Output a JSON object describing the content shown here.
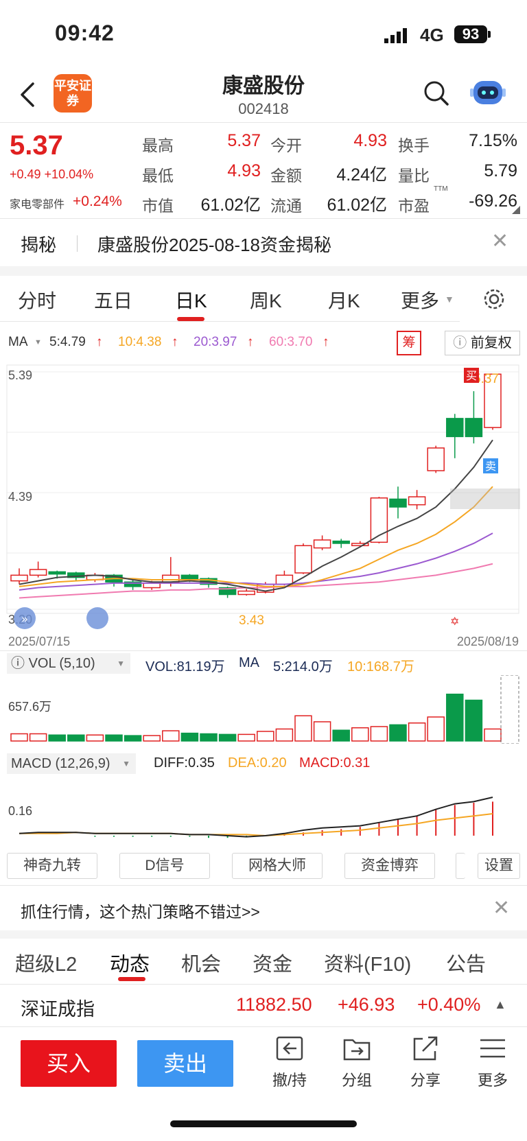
{
  "status": {
    "time": "09:42",
    "network": "4G",
    "battery": "93"
  },
  "header": {
    "logo_text": "平安证券",
    "title": "康盛股份",
    "code": "002418"
  },
  "quote": {
    "price": "5.37",
    "change": "+0.49 +10.04%",
    "sector": "家电零部件",
    "sector_change": "+0.24%",
    "labels": {
      "high": "最高",
      "open": "今开",
      "turnover": "换手",
      "low": "最低",
      "amount": "金额",
      "vol_ratio": "量比",
      "mktcap": "市值",
      "float": "流通",
      "pe": "市盈"
    },
    "values": {
      "high": "5.37",
      "open": "4.93",
      "turnover": "7.15%",
      "low": "4.93",
      "amount": "4.24亿",
      "vol_ratio": "5.79",
      "mktcap": "61.02亿",
      "float": "61.02亿",
      "pe": "-69.26"
    },
    "pe_superscript": "TTM"
  },
  "jiemi": {
    "label": "揭秘",
    "text": "康盛股份2025-08-18资金揭秘"
  },
  "chart_tabs": [
    "分时",
    "五日",
    "日K",
    "周K",
    "月K",
    "更多"
  ],
  "ma_legend": {
    "name": "MA",
    "ma5": "5:4.79",
    "ma10": "10:4.38",
    "ma20": "20:3.97",
    "ma60": "60:3.70"
  },
  "chip_button": "筹",
  "fuquan_button": "前复权",
  "kline": {
    "y_top": "5.39",
    "y_mid": "4.39",
    "y_bottom": "3.20",
    "date_start": "2025/07/15",
    "date_end": "2025/08/19",
    "low_marker": "3.43",
    "high_marker": "5.37",
    "buy_tag": "买",
    "sell_tag": "卖"
  },
  "volume": {
    "label": "VOL (5,10)",
    "vol": "VOL:81.19万",
    "ma_name": "MA",
    "ma5": "5:214.0万",
    "ma10": "10:168.7万",
    "y_label": "657.6万"
  },
  "macd": {
    "label": "MACD (12,26,9)",
    "diff": "DIFF:0.35",
    "dea": "DEA:0.20",
    "macd": "MACD:0.31",
    "y_label": "0.16"
  },
  "tools": [
    "神奇九转",
    "D信号",
    "网格大师",
    "资金博弈",
    "设置"
  ],
  "promo": "抓住行情，这个热门策略不错过>>",
  "bottom_tabs": [
    "超级L2",
    "动态",
    "机会",
    "资金",
    "资料(F10)",
    "公告"
  ],
  "index": {
    "name": "深证成指",
    "value": "11882.50",
    "change": "+46.93",
    "pct": "+0.40%"
  },
  "actions": {
    "buy": "买入",
    "sell": "卖出",
    "withdraw": "撤/持",
    "group": "分组",
    "share": "分享",
    "more": "更多"
  },
  "colors": {
    "up": "#e02020",
    "down": "#0a9a4a",
    "ma5": "#444444",
    "ma10": "#f5a623",
    "ma20": "#9b59d0",
    "ma60": "#f07ab0",
    "accent": "#f26522"
  },
  "candles": [
    {
      "o": 3.55,
      "c": 3.6,
      "h": 3.66,
      "l": 3.52
    },
    {
      "o": 3.6,
      "c": 3.65,
      "h": 3.72,
      "l": 3.58
    },
    {
      "o": 3.63,
      "c": 3.61,
      "h": 3.64,
      "l": 3.57
    },
    {
      "o": 3.62,
      "c": 3.58,
      "h": 3.63,
      "l": 3.55
    },
    {
      "o": 3.56,
      "c": 3.6,
      "h": 3.62,
      "l": 3.54
    },
    {
      "o": 3.6,
      "c": 3.54,
      "h": 3.61,
      "l": 3.5
    },
    {
      "o": 3.54,
      "c": 3.5,
      "h": 3.56,
      "l": 3.47
    },
    {
      "o": 3.49,
      "c": 3.53,
      "h": 3.55,
      "l": 3.47
    },
    {
      "o": 3.54,
      "c": 3.6,
      "h": 3.76,
      "l": 3.5
    },
    {
      "o": 3.6,
      "c": 3.56,
      "h": 3.61,
      "l": 3.54
    },
    {
      "o": 3.57,
      "c": 3.52,
      "h": 3.58,
      "l": 3.49
    },
    {
      "o": 3.49,
      "c": 3.43,
      "h": 3.5,
      "l": 3.4
    },
    {
      "o": 3.43,
      "c": 3.46,
      "h": 3.48,
      "l": 3.42
    },
    {
      "o": 3.45,
      "c": 3.52,
      "h": 3.54,
      "l": 3.44
    },
    {
      "o": 3.52,
      "c": 3.6,
      "h": 3.64,
      "l": 3.51
    },
    {
      "o": 3.62,
      "c": 3.86,
      "h": 3.88,
      "l": 3.61
    },
    {
      "o": 3.84,
      "c": 3.91,
      "h": 3.95,
      "l": 3.82
    },
    {
      "o": 3.9,
      "c": 3.88,
      "h": 3.92,
      "l": 3.84
    },
    {
      "o": 3.86,
      "c": 3.88,
      "h": 3.9,
      "l": 3.85
    },
    {
      "o": 3.89,
      "c": 4.28,
      "h": 4.29,
      "l": 3.88
    },
    {
      "o": 4.27,
      "c": 4.2,
      "h": 4.38,
      "l": 4.1
    },
    {
      "o": 4.22,
      "c": 4.29,
      "h": 4.35,
      "l": 4.18
    },
    {
      "o": 4.52,
      "c": 4.72,
      "h": 4.74,
      "l": 4.5
    },
    {
      "o": 4.98,
      "c": 4.82,
      "h": 5.02,
      "l": 4.63
    },
    {
      "o": 4.98,
      "c": 4.82,
      "h": 5.22,
      "l": 4.76
    },
    {
      "o": 4.9,
      "c": 5.37,
      "h": 5.37,
      "l": 4.88
    }
  ],
  "volumes": [
    12,
    12,
    10,
    10,
    10,
    10,
    9,
    9,
    17,
    13,
    12,
    11,
    11,
    16,
    20,
    42,
    32,
    18,
    22,
    24,
    27,
    30,
    40,
    78,
    68,
    20
  ],
  "macd_bars": [
    0,
    0,
    0,
    0,
    -0.01,
    -0.01,
    -0.01,
    -0.01,
    -0.01,
    -0.01,
    -0.02,
    -0.02,
    -0.01,
    0,
    0.01,
    0.03,
    0.05,
    0.06,
    0.08,
    0.12,
    0.15,
    0.18,
    0.24,
    0.28,
    0.3,
    0.31
  ],
  "diff_line": [
    0.02,
    0.03,
    0.03,
    0.03,
    0.02,
    0.02,
    0.02,
    0.02,
    0.02,
    0.01,
    0.01,
    0.0,
    -0.01,
    0.0,
    0.02,
    0.05,
    0.07,
    0.08,
    0.09,
    0.12,
    0.15,
    0.18,
    0.24,
    0.29,
    0.31,
    0.35
  ],
  "dea_line": [
    0.02,
    0.02,
    0.02,
    0.03,
    0.02,
    0.02,
    0.02,
    0.02,
    0.02,
    0.01,
    0.01,
    0.01,
    0.01,
    0.0,
    0.01,
    0.02,
    0.03,
    0.04,
    0.05,
    0.07,
    0.09,
    0.11,
    0.14,
    0.16,
    0.18,
    0.2
  ],
  "ma_series": {
    "ma5": [
      3.52,
      3.55,
      3.58,
      3.59,
      3.6,
      3.59,
      3.56,
      3.54,
      3.54,
      3.55,
      3.54,
      3.52,
      3.49,
      3.46,
      3.49,
      3.58,
      3.68,
      3.76,
      3.85,
      3.95,
      4.03,
      4.1,
      4.2,
      4.36,
      4.55,
      4.79
    ],
    "ma10": [
      3.5,
      3.52,
      3.54,
      3.55,
      3.56,
      3.57,
      3.57,
      3.56,
      3.56,
      3.56,
      3.56,
      3.54,
      3.52,
      3.5,
      3.5,
      3.52,
      3.56,
      3.61,
      3.66,
      3.74,
      3.82,
      3.88,
      3.96,
      4.07,
      4.2,
      4.38
    ],
    "ma20": [
      3.47,
      3.49,
      3.5,
      3.51,
      3.52,
      3.53,
      3.53,
      3.53,
      3.53,
      3.53,
      3.53,
      3.53,
      3.53,
      3.52,
      3.52,
      3.53,
      3.55,
      3.57,
      3.59,
      3.62,
      3.66,
      3.7,
      3.75,
      3.81,
      3.88,
      3.97
    ],
    "ma60": [
      3.4,
      3.41,
      3.42,
      3.43,
      3.44,
      3.45,
      3.46,
      3.46,
      3.47,
      3.47,
      3.48,
      3.48,
      3.49,
      3.49,
      3.5,
      3.5,
      3.51,
      3.52,
      3.53,
      3.54,
      3.56,
      3.58,
      3.6,
      3.63,
      3.66,
      3.7
    ]
  }
}
